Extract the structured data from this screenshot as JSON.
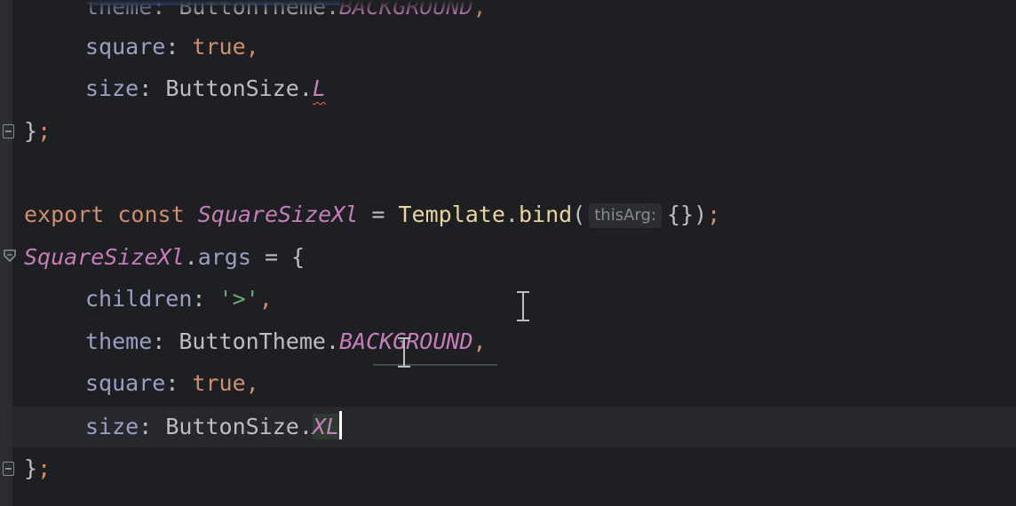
{
  "editor": {
    "lines": {
      "l0": {
        "a": "theme",
        "b": ": ",
        "c": "ButtonTheme.",
        "d": "BACKGROUND",
        "e": ","
      },
      "l1": {
        "a": "square",
        "b": ": ",
        "c": "true",
        "d": ","
      },
      "l2": {
        "a": "size",
        "b": ": ",
        "c": "ButtonSize.",
        "d": "L"
      },
      "l3": {
        "a": "}",
        "b": ";"
      },
      "l5": {
        "kw1": "export",
        "kw2": "const",
        "name": "SquareSizeXl",
        "eq": " = ",
        "tmpl": "Template",
        "dot": ".",
        "fn": "bind",
        "open": "(",
        "hint": "thisArg:",
        "obj": "{}",
        "close": ")",
        "semi": ";"
      },
      "l6": {
        "name": "SquareSizeXl",
        "dot": ".",
        "prop": "args",
        "rest": " = {"
      },
      "l7": {
        "a": "children",
        "b": ": ",
        "c": "'>'",
        "d": ","
      },
      "l8": {
        "a": "theme",
        "b": ": ",
        "c": "ButtonTheme.",
        "d": "BACKGROUND",
        "e": ","
      },
      "l9": {
        "a": "square",
        "b": ": ",
        "c": "true",
        "d": ","
      },
      "l10": {
        "a": "size",
        "b": ": ",
        "c": "ButtonSize.",
        "d": "XL"
      },
      "l11": {
        "a": "}",
        "b": ";"
      }
    },
    "icons": {
      "fold_close": "fold-close-icon",
      "fold_open": "fold-open-icon",
      "text_cursor": "text-cursor-icon"
    },
    "colors": {
      "background": "#1e1f22",
      "keyword": "#cf8e6d",
      "property": "#9aa0c2",
      "constant": "#c77dbb",
      "string": "#6aab73",
      "scroll_accent": "#3574f0"
    }
  }
}
